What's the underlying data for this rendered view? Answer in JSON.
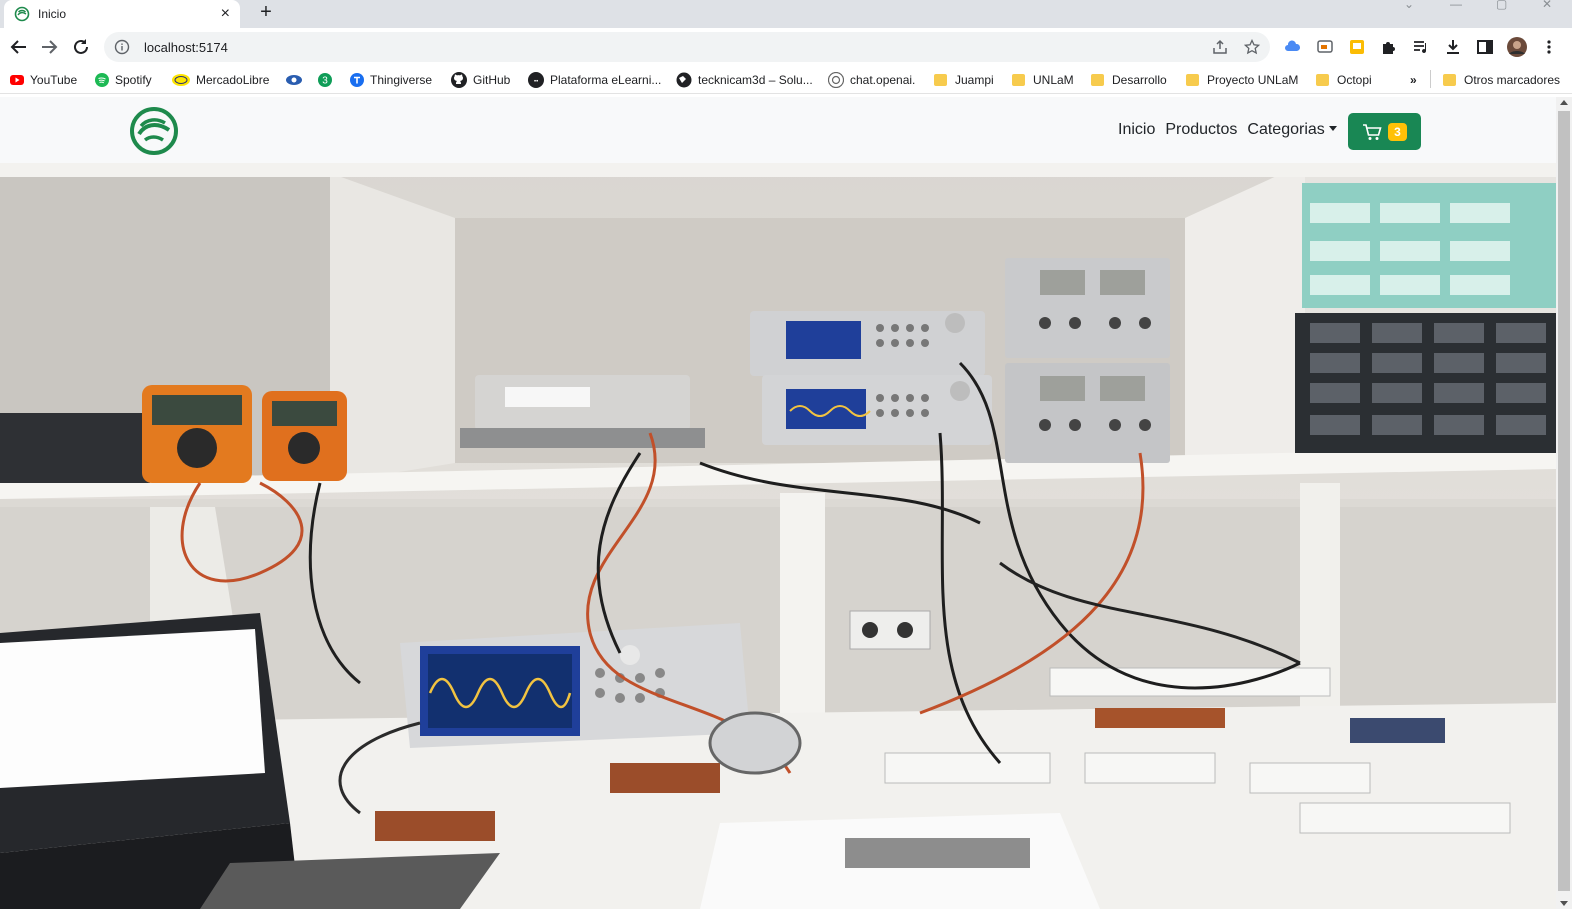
{
  "browser": {
    "tab": {
      "title": "Inicio",
      "close": "×"
    },
    "new_tab": "+",
    "url": "localhost:5174",
    "bookmarks": [
      {
        "label": "YouTube",
        "icon": "youtube-icon"
      },
      {
        "label": "Spotify",
        "icon": "spotify-icon"
      },
      {
        "label": "MercadoLibre",
        "icon": "mercadolibre-icon"
      },
      {
        "label": "",
        "icon": "eye-icon"
      },
      {
        "label": "",
        "icon": "badge-3-icon",
        "badge": "3"
      },
      {
        "label": "Thingiverse",
        "icon": "thingiverse-icon"
      },
      {
        "label": "GitHub",
        "icon": "github-icon"
      },
      {
        "label": "Plataforma eLearni...",
        "icon": "elearning-icon"
      },
      {
        "label": "tecknicam3d – Solu...",
        "icon": "globe-icon"
      },
      {
        "label": "chat.openai.",
        "icon": "openai-icon"
      },
      {
        "label": "Juampi",
        "icon": "folder-icon"
      },
      {
        "label": "UNLaM",
        "icon": "folder-icon"
      },
      {
        "label": "Desarrollo",
        "icon": "folder-icon"
      },
      {
        "label": "Proyecto UNLaM",
        "icon": "folder-icon"
      },
      {
        "label": "Octopi",
        "icon": "folder-icon"
      }
    ],
    "more": "»",
    "other_bookmarks": "Otros marcadores"
  },
  "navbar": {
    "links": [
      "Inicio",
      "Productos"
    ],
    "dropdown": "Categorias",
    "cart_count": "3"
  },
  "colors": {
    "brand_green": "#198754",
    "badge_yellow": "#ffc107",
    "logo_green": "#1e8a4c"
  },
  "hero": {
    "icon": "electronics-lab-photo"
  }
}
